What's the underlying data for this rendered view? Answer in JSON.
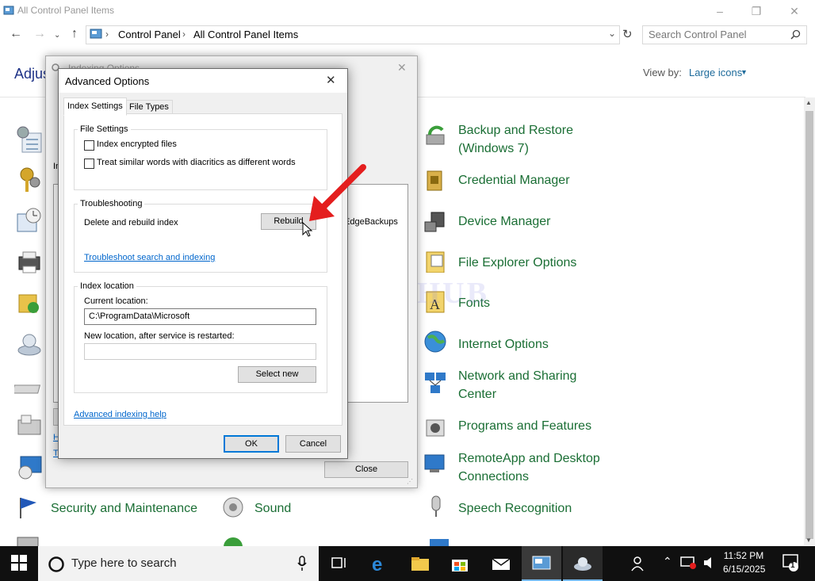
{
  "window": {
    "title": "All Control Panel Items",
    "breadcrumb": [
      "Control Panel",
      "All Control Panel Items"
    ],
    "search_placeholder": "Search Control Panel",
    "heading": "Adjus",
    "view_by_label": "View by:",
    "view_by_value": "Large icons"
  },
  "control_panel_items": {
    "right_column": [
      {
        "label": "Backup and Restore\n(Windows 7)",
        "icon": "backup-icon"
      },
      {
        "label": "Credential Manager",
        "icon": "credential-icon"
      },
      {
        "label": "Device Manager",
        "icon": "device-manager-icon"
      },
      {
        "label": "File Explorer Options",
        "icon": "folder-options-icon"
      },
      {
        "label": "Fonts",
        "icon": "fonts-icon"
      },
      {
        "label": "Internet Options",
        "icon": "globe-icon"
      },
      {
        "label": "Network and Sharing\nCenter",
        "icon": "network-icon"
      },
      {
        "label": "Programs and Features",
        "icon": "programs-icon"
      },
      {
        "label": "RemoteApp and Desktop\nConnections",
        "icon": "remoteapp-icon"
      },
      {
        "label": "Speech Recognition",
        "icon": "microphone-icon"
      }
    ],
    "bottom_row": [
      {
        "label": "Security and Maintenance",
        "icon": "flag-icon"
      },
      {
        "label": "Sound",
        "icon": "speaker-icon"
      }
    ]
  },
  "indexing_dialog": {
    "title": "Indexing Options",
    "partial_text": "EdgeBackups",
    "close_button": "Close",
    "letter_i": "In",
    "letter_h": "H",
    "letter_t": "T"
  },
  "advanced_dialog": {
    "title": "Advanced Options",
    "tabs": [
      "Index Settings",
      "File Types"
    ],
    "file_settings": {
      "legend": "File Settings",
      "checkbox1": "Index encrypted files",
      "checkbox2": "Treat similar words with diacritics as different words"
    },
    "troubleshooting": {
      "legend": "Troubleshooting",
      "rebuild_label": "Delete and rebuild index",
      "rebuild_button": "Rebuild",
      "link": "Troubleshoot search and indexing"
    },
    "index_location": {
      "legend": "Index location",
      "current_label": "Current location:",
      "current_value": "C:\\ProgramData\\Microsoft",
      "new_label": "New location, after service is restarted:",
      "new_value": "",
      "select_button": "Select new"
    },
    "help_link": "Advanced indexing help",
    "ok_button": "OK",
    "cancel_button": "Cancel"
  },
  "taskbar": {
    "search_placeholder": "Type here to search",
    "time": "11:52 PM",
    "date": "6/15/2025",
    "notification_count": "1"
  },
  "watermark": "IT Pros HUB",
  "colors": {
    "link_green": "#1a6e34",
    "accent_arrow": "#e41e1e",
    "taskbar": "#101010"
  }
}
